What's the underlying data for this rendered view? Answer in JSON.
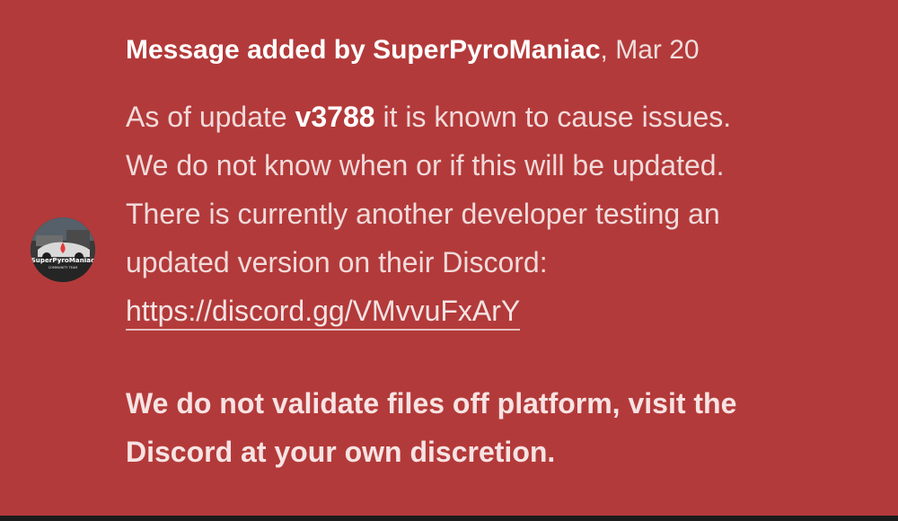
{
  "message": {
    "header_prefix": "Message added by SuperPyroManiac",
    "separator": ",",
    "date": "Mar 20",
    "body": {
      "line1_before": "As of update ",
      "line1_version": "v3788",
      "line1_after": " it is known to cause issues.",
      "line2": "We do not know when or if this will be updated.",
      "line3": "There is currently another developer testing an",
      "line4": "updated version on their Discord:",
      "link_text": "https://discord.gg/VMvvuFxArY"
    },
    "warning_line1": "We do not validate files off platform, visit the",
    "warning_line2": "Discord at your own discretion."
  },
  "avatar": {
    "logo_text": "SuperPyroManiac",
    "logo_subtext": "COMMUNITY TEAM"
  },
  "colors": {
    "background": "#b33a3a",
    "text": "#f1dada",
    "header_bold": "#ffffff",
    "bottom_bar": "#1b1b1b"
  }
}
